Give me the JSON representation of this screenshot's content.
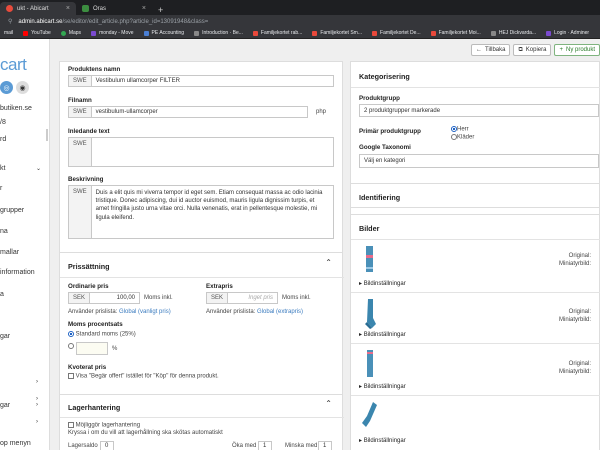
{
  "browser": {
    "tabs": [
      {
        "label": "ukt - Abicart",
        "active": true
      },
      {
        "label": "Oras",
        "active": false
      }
    ],
    "url_host": "admin.abicart.se",
    "url_path": "/se/editor/edit_article.php?article_id=13091948&class=",
    "bookmarks": [
      "mail",
      "YouTube",
      "Maps",
      "monday - Move",
      "PE Accounting",
      "Introduction · Be...",
      "Familjekortet rab...",
      "Familjekortet Sm...",
      "Familjekortet De...",
      "Familjekortet Moi...",
      "HEJ Dickvarda...",
      "Login · Adminer"
    ]
  },
  "sidebar": {
    "logo": "cart",
    "shop_name": "butiken.se",
    "items": [
      {
        "label": "/8",
        "chevron": false
      },
      {
        "label": "rd",
        "chevron": false
      },
      {
        "label": "kt",
        "chevron": true
      },
      {
        "label": "r",
        "chevron": false
      },
      {
        "label": "grupper",
        "chevron": false
      },
      {
        "label": "na",
        "chevron": false
      },
      {
        "label": "mallar",
        "chevron": false
      },
      {
        "label": "information",
        "chevron": false
      },
      {
        "label": "a",
        "chevron": false
      },
      {
        "label": "",
        "chevron": false
      },
      {
        "label": "gar",
        "chevron": false
      },
      {
        "label": "",
        "chevron": true
      },
      {
        "label": "",
        "chevron": true
      },
      {
        "label": "gar",
        "chevron": true
      },
      {
        "label": "",
        "chevron": true
      },
      {
        "label": "op menyn",
        "chevron": false
      }
    ]
  },
  "toolbar": {
    "back_label": "Tillbaka",
    "copy_label": "Kopiera",
    "new_label": "Ny produkt"
  },
  "product": {
    "name_label": "Produktens namn",
    "name_prefix": "SWE",
    "name_value": "Vestibulum ullamcorper FILTER",
    "filename_label": "Filnamn",
    "filename_prefix": "SWE",
    "filename_value": "vestibulum-ullamcorper",
    "filename_suffix": "php",
    "intro_label": "Inledande text",
    "intro_prefix": "SWE",
    "desc_label": "Beskrivning",
    "desc_prefix": "SWE",
    "desc_value": "Duis a elit quis mi viverra tempor id eget sem. Etiam consequat massa ac odio lacinia tristique. Donec adipiscing, dui id auctor euismod, mauris ligula dignissim turpis, et amet fringilla justo urna vitae orci. Nulla venenatis, erat in pellentesque molestie, mi ligula eleifend."
  },
  "pricing": {
    "title": "Prissättning",
    "ordinary_label": "Ordinarie pris",
    "ordinary_prefix": "SEK",
    "ordinary_value": "100,00",
    "ordinary_suffix": "Moms inkl.",
    "ordinary_list_prefix": "Använder prislista:",
    "ordinary_list_link": "Global (vanligt pris)",
    "extra_label": "Extrapris",
    "extra_prefix": "SEK",
    "extra_placeholder": "Inget pris",
    "extra_suffix": "Moms inkl.",
    "extra_list_prefix": "Använder prislista:",
    "extra_list_link": "Global (extrapris)",
    "vat_label": "Moms procentsats",
    "vat_standard": "Standard moms (25%)",
    "vat_custom_suffix": "%",
    "quoted_label": "Kvoterat pris",
    "quoted_checkbox": "Visa \"Begär offert\" istället för \"Köp\" för denna produkt."
  },
  "inventory": {
    "title": "Lagerhantering",
    "enable_label": "Möjliggör lagerhantering",
    "enable_help": "Kryssa i om du vill att lagerhållning ska skötas automatiskt",
    "stock_label": "Lagersaldo",
    "stock_value": "0",
    "increase_label": "Öka med",
    "increase_value": "1",
    "decrease_label": "Minska med",
    "decrease_value": "1"
  },
  "categorization": {
    "title": "Kategorisering",
    "group_label": "Produktgrupp",
    "group_value": "2 produktgrupper markerade",
    "primary_label": "Primär produktgrupp",
    "primary_options": [
      {
        "label": "Herr",
        "checked": true
      },
      {
        "label": "Kläder",
        "checked": false
      }
    ],
    "taxonomy_label": "Google Taxonomi",
    "taxonomy_value": "Välj en kategori"
  },
  "identification": {
    "title": "Identifiering"
  },
  "images": {
    "title": "Bilder",
    "items": [
      {
        "settings": "Bildinställningar",
        "line1": "Original:",
        "line2": "Miniatyrbild:"
      },
      {
        "settings": "Bildinställningar",
        "line1": "Original:",
        "line2": "Miniatyrbild:"
      },
      {
        "settings": "Bildinställningar",
        "line1": "Original:",
        "line2": "Miniatyrbild:"
      },
      {
        "settings": "Bildinställningar",
        "line1": "",
        "line2": ""
      }
    ]
  },
  "colors": {
    "accent": "#5b9bd5",
    "link": "#3a7bbf",
    "sock": "#4a90b8"
  }
}
